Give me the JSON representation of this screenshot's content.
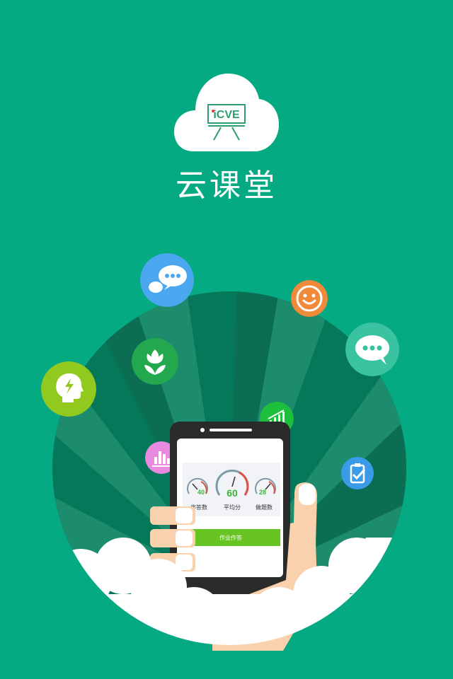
{
  "app": {
    "title": "云课堂",
    "logo_text": "iCVE"
  },
  "phone": {
    "gauges": [
      {
        "value": "40",
        "label": "作答数"
      },
      {
        "value": "60",
        "label": "平均分"
      },
      {
        "value": "28",
        "label": "做题数"
      }
    ],
    "button_label": "作业作答"
  },
  "icons": {
    "chat": "chat-bubble-icon",
    "smile": "smile-icon",
    "more": "more-dots-icon",
    "flower": "flower-icon",
    "brain": "head-idea-icon",
    "chart_green": "chart-icon",
    "bars": "bar-chart-icon",
    "clipboard": "clipboard-check-icon"
  },
  "colors": {
    "background": "#05A982",
    "disc_dark": "#06785A",
    "disc_light": "#1B8A6B",
    "chat": "#4AA7F0",
    "smile": "#F08A3A",
    "more": "#39C3A1",
    "flower": "#23A84D",
    "brain": "#92C91F",
    "chart_green": "#1DBF3C",
    "bars": "#E88BE0",
    "clipboard": "#3A9BE8",
    "button": "#68C422",
    "gauge_value": "#3EB43B"
  }
}
